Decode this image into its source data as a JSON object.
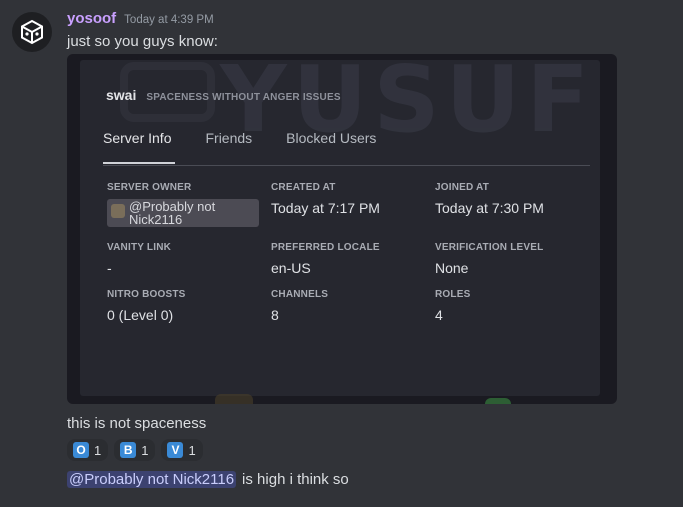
{
  "message": {
    "username": "yosoof",
    "timestamp": "Today at 4:39 PM",
    "text1": "just so you guys know:",
    "text2": "this is not spaceness",
    "mention": "@Probably not Nick2116",
    "text3": "is high i think so"
  },
  "screenshot": {
    "watermark": "YUSUF",
    "server_name": "swai",
    "server_description": "SPACENESS WITHOUT ANGER ISSUES",
    "tabs": [
      "Server Info",
      "Friends",
      "Blocked Users"
    ],
    "active_tab": "Server Info",
    "fields": {
      "server_owner": {
        "label": "SERVER OWNER",
        "value": "@Probably not Nick2116"
      },
      "created_at": {
        "label": "CREATED AT",
        "value": "Today at 7:17 PM"
      },
      "joined_at": {
        "label": "JOINED AT",
        "value": "Today at 7:30 PM"
      },
      "vanity_link": {
        "label": "VANITY LINK",
        "value": "-"
      },
      "preferred_locale": {
        "label": "PREFERRED LOCALE",
        "value": "en-US"
      },
      "verification_level": {
        "label": "VERIFICATION LEVEL",
        "value": "None"
      },
      "nitro_boosts": {
        "label": "NITRO BOOSTS",
        "value": "0 (Level 0)"
      },
      "channels": {
        "label": "CHANNELS",
        "value": "8"
      },
      "roles": {
        "label": "ROLES",
        "value": "4"
      }
    }
  },
  "reactions": [
    {
      "letter": "O",
      "count": "1"
    },
    {
      "letter": "B",
      "count": "1"
    },
    {
      "letter": "V",
      "count": "1"
    }
  ],
  "colors": {
    "background": "#313338",
    "username": "#c9a0ff",
    "mention_bg": "#3c4270",
    "reaction_box": "#3a8ad6"
  }
}
